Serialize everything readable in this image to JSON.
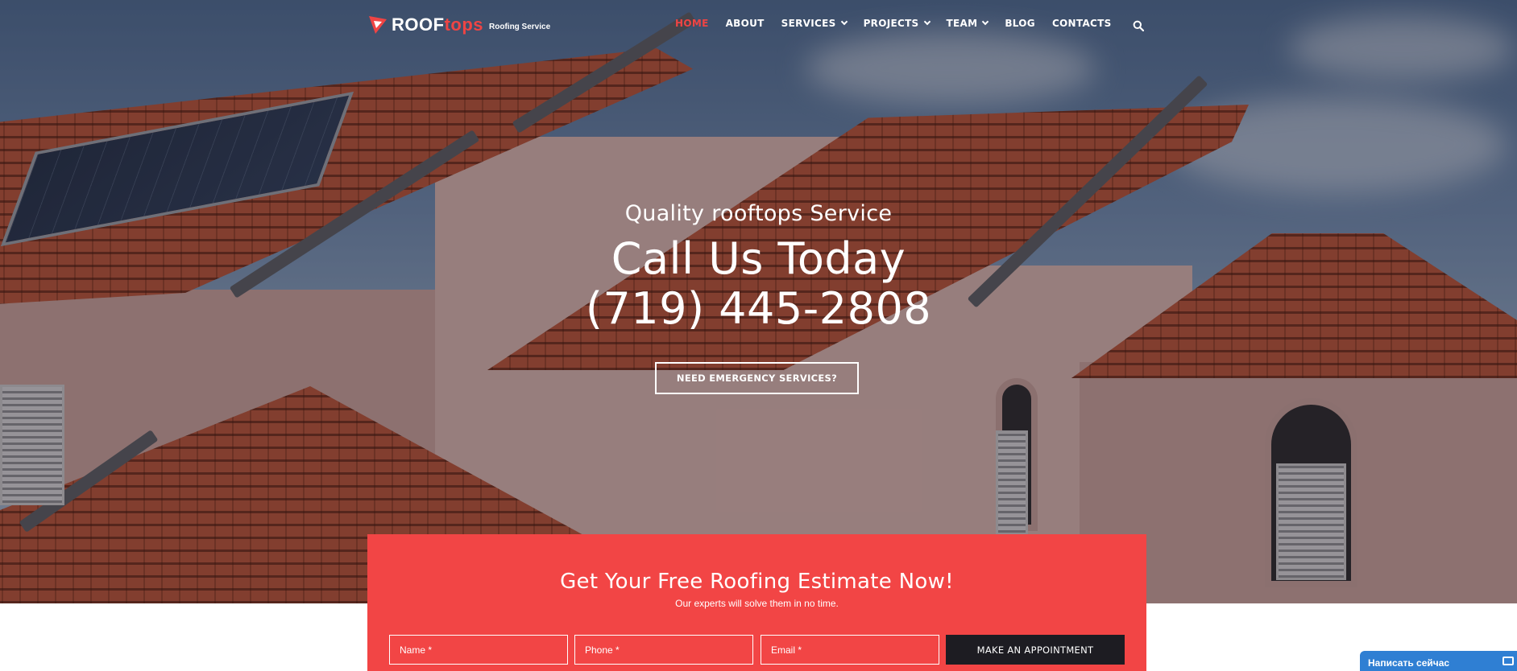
{
  "nav": {
    "logo_main": "ROOF",
    "logo_accent": "tops",
    "logo_tagline": "Roofing Service",
    "items": [
      {
        "label": "HOME",
        "active": true,
        "dropdown": false
      },
      {
        "label": "ABOUT",
        "active": false,
        "dropdown": false
      },
      {
        "label": "SERVICES",
        "active": false,
        "dropdown": true
      },
      {
        "label": "PROJECTS",
        "active": false,
        "dropdown": true
      },
      {
        "label": "TEAM",
        "active": false,
        "dropdown": true
      },
      {
        "label": "BLOG",
        "active": false,
        "dropdown": false
      },
      {
        "label": "CONTACTS",
        "active": false,
        "dropdown": false
      }
    ],
    "search_icon": "search-icon"
  },
  "hero": {
    "tagline": "Quality rooftops Service",
    "headline_line1": "Call Us Today",
    "headline_line2": "(719) 445-2808",
    "cta_label": "NEED EMERGENCY SERVICES?"
  },
  "estimate": {
    "title": "Get Your Free Roofing Estimate Now!",
    "subtitle": "Our experts will solve them in no time.",
    "name_placeholder": "Name *",
    "phone_placeholder": "Phone *",
    "email_placeholder": "Email *",
    "button_label": "MAKE AN APPOINTMENT"
  },
  "chat": {
    "label": "Написать сейчас"
  },
  "colors": {
    "accent": "#ef4444",
    "panel": "#f24545",
    "button_dark": "#1d1c22",
    "chat_blue": "#2f7fd3"
  }
}
